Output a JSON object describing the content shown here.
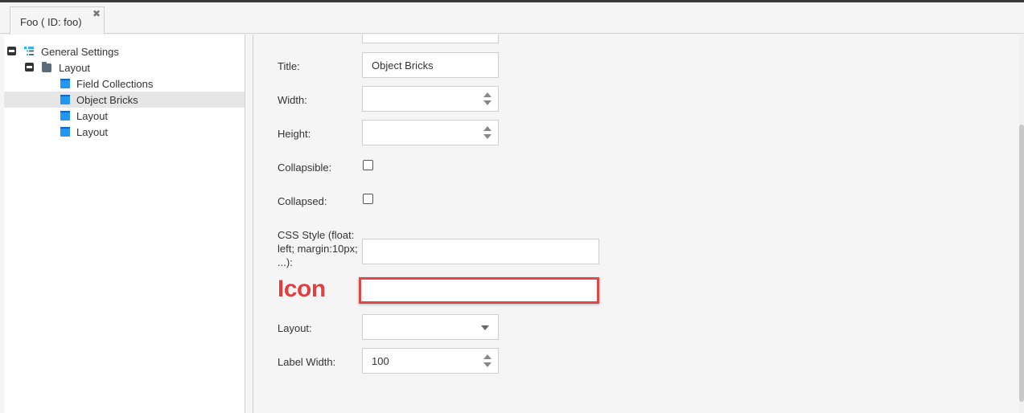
{
  "tab": {
    "label": "Foo ( ID: foo)",
    "close_glyph": "✖"
  },
  "tree": {
    "root": {
      "label": "General Settings",
      "icon": "hierarchy-icon",
      "icon_color": "#29b6f6"
    },
    "layout_folder": {
      "label": "Layout",
      "icon": "folder-icon"
    },
    "children": [
      {
        "label": "Field Collections",
        "icon": "brick-icon",
        "selected": false
      },
      {
        "label": "Object Bricks",
        "icon": "brick-icon",
        "selected": true
      },
      {
        "label": "Layout",
        "icon": "brick-icon",
        "selected": false
      },
      {
        "label": "Layout",
        "icon": "brick-icon",
        "selected": false
      }
    ]
  },
  "form": {
    "title_label": "Title:",
    "title_value": "Object Bricks",
    "width_label": "Width:",
    "width_value": "",
    "height_label": "Height:",
    "height_value": "",
    "collapsible_label": "Collapsible:",
    "collapsible_checked": false,
    "collapsed_label": "Collapsed:",
    "collapsed_checked": false,
    "css_style_label": "CSS Style (float: left; margin:10px; ...):",
    "css_style_value": "",
    "icon_value": "",
    "layout_label": "Layout:",
    "layout_value": "",
    "label_width_label": "Label Width:",
    "label_width_value": "100"
  },
  "annotation": {
    "label": "Icon",
    "color": "#e04848"
  },
  "colors": {
    "accent_blue": "#2196f3",
    "selected_row": "#e6e6e6"
  }
}
